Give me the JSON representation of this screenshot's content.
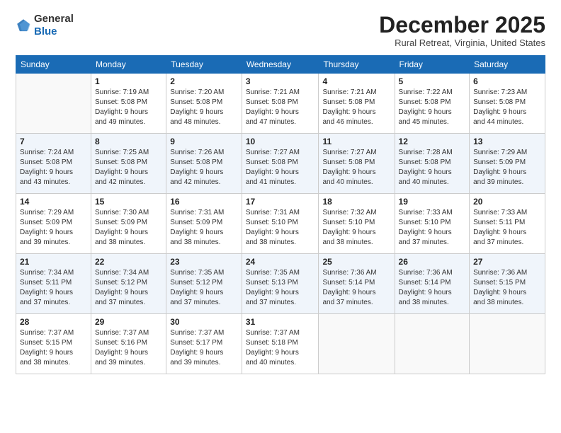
{
  "header": {
    "logo": {
      "line1": "General",
      "line2": "Blue"
    },
    "title": "December 2025",
    "location": "Rural Retreat, Virginia, United States"
  },
  "weekdays": [
    "Sunday",
    "Monday",
    "Tuesday",
    "Wednesday",
    "Thursday",
    "Friday",
    "Saturday"
  ],
  "weeks": [
    [
      {
        "day": "",
        "info": ""
      },
      {
        "day": "1",
        "info": "Sunrise: 7:19 AM\nSunset: 5:08 PM\nDaylight: 9 hours\nand 49 minutes."
      },
      {
        "day": "2",
        "info": "Sunrise: 7:20 AM\nSunset: 5:08 PM\nDaylight: 9 hours\nand 48 minutes."
      },
      {
        "day": "3",
        "info": "Sunrise: 7:21 AM\nSunset: 5:08 PM\nDaylight: 9 hours\nand 47 minutes."
      },
      {
        "day": "4",
        "info": "Sunrise: 7:21 AM\nSunset: 5:08 PM\nDaylight: 9 hours\nand 46 minutes."
      },
      {
        "day": "5",
        "info": "Sunrise: 7:22 AM\nSunset: 5:08 PM\nDaylight: 9 hours\nand 45 minutes."
      },
      {
        "day": "6",
        "info": "Sunrise: 7:23 AM\nSunset: 5:08 PM\nDaylight: 9 hours\nand 44 minutes."
      }
    ],
    [
      {
        "day": "7",
        "info": "Sunrise: 7:24 AM\nSunset: 5:08 PM\nDaylight: 9 hours\nand 43 minutes."
      },
      {
        "day": "8",
        "info": "Sunrise: 7:25 AM\nSunset: 5:08 PM\nDaylight: 9 hours\nand 42 minutes."
      },
      {
        "day": "9",
        "info": "Sunrise: 7:26 AM\nSunset: 5:08 PM\nDaylight: 9 hours\nand 42 minutes."
      },
      {
        "day": "10",
        "info": "Sunrise: 7:27 AM\nSunset: 5:08 PM\nDaylight: 9 hours\nand 41 minutes."
      },
      {
        "day": "11",
        "info": "Sunrise: 7:27 AM\nSunset: 5:08 PM\nDaylight: 9 hours\nand 40 minutes."
      },
      {
        "day": "12",
        "info": "Sunrise: 7:28 AM\nSunset: 5:08 PM\nDaylight: 9 hours\nand 40 minutes."
      },
      {
        "day": "13",
        "info": "Sunrise: 7:29 AM\nSunset: 5:09 PM\nDaylight: 9 hours\nand 39 minutes."
      }
    ],
    [
      {
        "day": "14",
        "info": "Sunrise: 7:29 AM\nSunset: 5:09 PM\nDaylight: 9 hours\nand 39 minutes."
      },
      {
        "day": "15",
        "info": "Sunrise: 7:30 AM\nSunset: 5:09 PM\nDaylight: 9 hours\nand 38 minutes."
      },
      {
        "day": "16",
        "info": "Sunrise: 7:31 AM\nSunset: 5:09 PM\nDaylight: 9 hours\nand 38 minutes."
      },
      {
        "day": "17",
        "info": "Sunrise: 7:31 AM\nSunset: 5:10 PM\nDaylight: 9 hours\nand 38 minutes."
      },
      {
        "day": "18",
        "info": "Sunrise: 7:32 AM\nSunset: 5:10 PM\nDaylight: 9 hours\nand 38 minutes."
      },
      {
        "day": "19",
        "info": "Sunrise: 7:33 AM\nSunset: 5:10 PM\nDaylight: 9 hours\nand 37 minutes."
      },
      {
        "day": "20",
        "info": "Sunrise: 7:33 AM\nSunset: 5:11 PM\nDaylight: 9 hours\nand 37 minutes."
      }
    ],
    [
      {
        "day": "21",
        "info": "Sunrise: 7:34 AM\nSunset: 5:11 PM\nDaylight: 9 hours\nand 37 minutes."
      },
      {
        "day": "22",
        "info": "Sunrise: 7:34 AM\nSunset: 5:12 PM\nDaylight: 9 hours\nand 37 minutes."
      },
      {
        "day": "23",
        "info": "Sunrise: 7:35 AM\nSunset: 5:12 PM\nDaylight: 9 hours\nand 37 minutes."
      },
      {
        "day": "24",
        "info": "Sunrise: 7:35 AM\nSunset: 5:13 PM\nDaylight: 9 hours\nand 37 minutes."
      },
      {
        "day": "25",
        "info": "Sunrise: 7:36 AM\nSunset: 5:14 PM\nDaylight: 9 hours\nand 37 minutes."
      },
      {
        "day": "26",
        "info": "Sunrise: 7:36 AM\nSunset: 5:14 PM\nDaylight: 9 hours\nand 38 minutes."
      },
      {
        "day": "27",
        "info": "Sunrise: 7:36 AM\nSunset: 5:15 PM\nDaylight: 9 hours\nand 38 minutes."
      }
    ],
    [
      {
        "day": "28",
        "info": "Sunrise: 7:37 AM\nSunset: 5:15 PM\nDaylight: 9 hours\nand 38 minutes."
      },
      {
        "day": "29",
        "info": "Sunrise: 7:37 AM\nSunset: 5:16 PM\nDaylight: 9 hours\nand 39 minutes."
      },
      {
        "day": "30",
        "info": "Sunrise: 7:37 AM\nSunset: 5:17 PM\nDaylight: 9 hours\nand 39 minutes."
      },
      {
        "day": "31",
        "info": "Sunrise: 7:37 AM\nSunset: 5:18 PM\nDaylight: 9 hours\nand 40 minutes."
      },
      {
        "day": "",
        "info": ""
      },
      {
        "day": "",
        "info": ""
      },
      {
        "day": "",
        "info": ""
      }
    ]
  ]
}
